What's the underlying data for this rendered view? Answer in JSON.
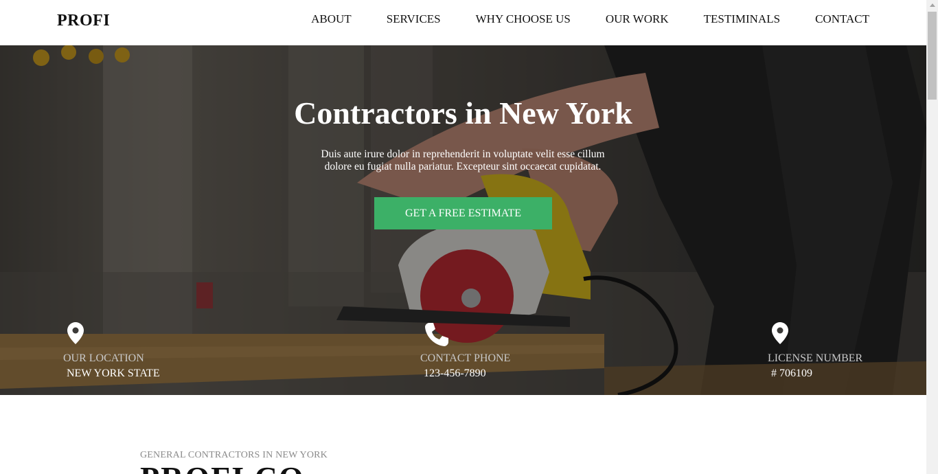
{
  "navbar": {
    "brand": "PROFI",
    "links": [
      "ABOUT",
      "SERVICES",
      "WHY CHOOSE US",
      "OUR WORK",
      "TESTIMINALS",
      "CONTACT"
    ]
  },
  "hero": {
    "title": "Contractors in New York",
    "text": "Duis aute irure dolor in reprehenderit in voluptate velit esse cillum dolore eu fugiat nulla pariatur. Excepteur sint occaecat cupidatat.",
    "cta_label": "GET A FREE ESTIMATE",
    "cta_color": "#3cb067",
    "info": [
      {
        "icon": "location-pin-icon",
        "label": "OUR LOCATION",
        "value": "NEW YORK STATE"
      },
      {
        "icon": "phone-icon",
        "label": "CONTACT PHONE",
        "value": "123-456-7890"
      },
      {
        "icon": "location-pin-icon",
        "label": "LICENSE NUMBER",
        "value": "# 706109"
      }
    ]
  },
  "about": {
    "kicker": "GENERAL CONTRACTORS IN NEW YORK",
    "heading": "PROFI CO"
  }
}
